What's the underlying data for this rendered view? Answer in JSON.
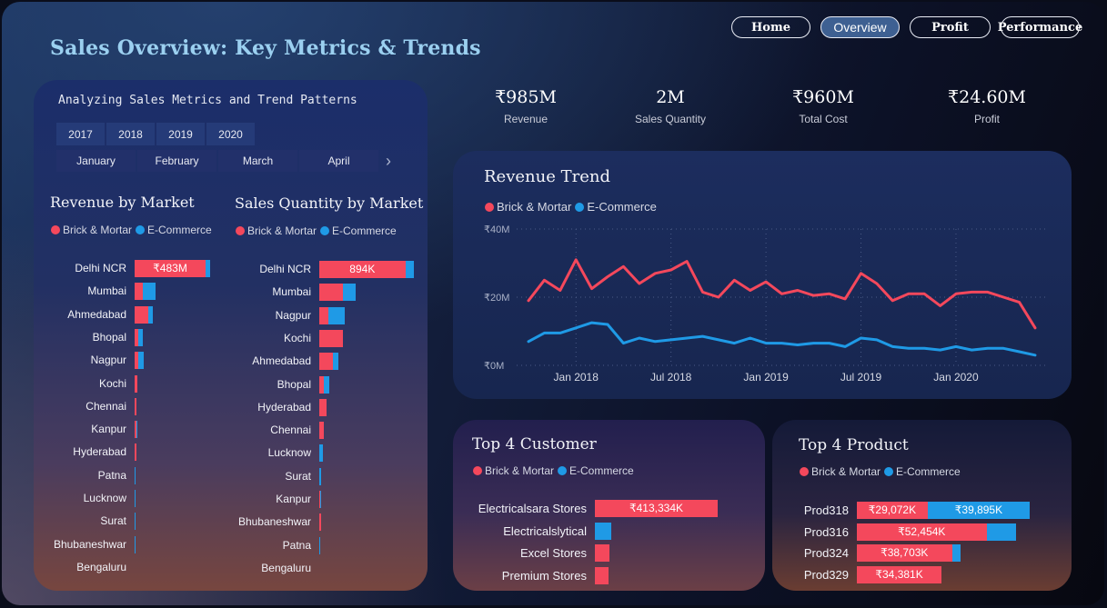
{
  "page_title": "Sales Overview: Key Metrics & Trends",
  "nav": [
    {
      "label": "Home",
      "active": false,
      "width": 87
    },
    {
      "label": "Overview",
      "active": true,
      "width": 87
    },
    {
      "label": "Profit",
      "active": false,
      "width": 89
    },
    {
      "label": "Performance",
      "active": false,
      "width": 87
    }
  ],
  "subheading": "Analyzing Sales Metrics and Trend Patterns",
  "years": [
    "2017",
    "2018",
    "2019",
    "2020"
  ],
  "months": [
    "January",
    "February",
    "March",
    "April"
  ],
  "kpis": [
    {
      "value": "₹985M",
      "label": "Revenue"
    },
    {
      "value": "2M",
      "label": "Sales Quantity"
    },
    {
      "value": "₹960M",
      "label": "Total Cost"
    },
    {
      "value": "₹24.60M",
      "label": "Profit"
    }
  ],
  "legend": {
    "brick": "Brick & Mortar",
    "ecom": "E-Commerce"
  },
  "colors": {
    "brick": "#f4485c",
    "ecom": "#1f9ae6"
  },
  "revenue_by_market": {
    "title": "Revenue by Market",
    "rows": [
      {
        "label": "Delhi NCR",
        "brick": 1.0,
        "ecom": 0.07,
        "text": "₹483M"
      },
      {
        "label": "Mumbai",
        "brick": 0.12,
        "ecom": 0.17,
        "text": ""
      },
      {
        "label": "Ahmedabad",
        "brick": 0.19,
        "ecom": 0.07,
        "text": ""
      },
      {
        "label": "Bhopal",
        "brick": 0.05,
        "ecom": 0.06,
        "text": ""
      },
      {
        "label": "Nagpur",
        "brick": 0.05,
        "ecom": 0.08,
        "text": ""
      },
      {
        "label": "Kochi",
        "brick": 0.04,
        "ecom": 0.0,
        "text": ""
      },
      {
        "label": "Chennai",
        "brick": 0.03,
        "ecom": 0.0,
        "text": ""
      },
      {
        "label": "Kanpur",
        "brick": 0.02,
        "ecom": 0.01,
        "text": ""
      },
      {
        "label": "Hyderabad",
        "brick": 0.02,
        "ecom": 0.0,
        "text": ""
      },
      {
        "label": "Patna",
        "brick": 0.0,
        "ecom": 0.01,
        "text": ""
      },
      {
        "label": "Lucknow",
        "brick": 0.0,
        "ecom": 0.01,
        "text": ""
      },
      {
        "label": "Surat",
        "brick": 0.0,
        "ecom": 0.01,
        "text": ""
      },
      {
        "label": "Bhubaneshwar",
        "brick": 0.0,
        "ecom": 0.01,
        "text": ""
      },
      {
        "label": "Bengaluru",
        "brick": 0.0,
        "ecom": 0.0,
        "text": ""
      }
    ]
  },
  "quantity_by_market": {
    "title": "Sales Quantity by Market",
    "rows": [
      {
        "label": "Delhi NCR",
        "brick": 0.91,
        "ecom": 0.09,
        "text": "894K"
      },
      {
        "label": "Mumbai",
        "brick": 0.25,
        "ecom": 0.13,
        "text": ""
      },
      {
        "label": "Nagpur",
        "brick": 0.1,
        "ecom": 0.17,
        "text": ""
      },
      {
        "label": "Kochi",
        "brick": 0.25,
        "ecom": 0.0,
        "text": ""
      },
      {
        "label": "Ahmedabad",
        "brick": 0.14,
        "ecom": 0.06,
        "text": ""
      },
      {
        "label": "Bhopal",
        "brick": 0.05,
        "ecom": 0.06,
        "text": ""
      },
      {
        "label": "Hyderabad",
        "brick": 0.08,
        "ecom": 0.0,
        "text": ""
      },
      {
        "label": "Chennai",
        "brick": 0.05,
        "ecom": 0.0,
        "text": ""
      },
      {
        "label": "Lucknow",
        "brick": 0.0,
        "ecom": 0.04,
        "text": ""
      },
      {
        "label": "Surat",
        "brick": 0.0,
        "ecom": 0.02,
        "text": ""
      },
      {
        "label": "Kanpur",
        "brick": 0.01,
        "ecom": 0.01,
        "text": ""
      },
      {
        "label": "Bhubaneshwar",
        "brick": 0.02,
        "ecom": 0.0,
        "text": ""
      },
      {
        "label": "Patna",
        "brick": 0.0,
        "ecom": 0.01,
        "text": ""
      },
      {
        "label": "Bengaluru",
        "brick": 0.0,
        "ecom": 0.0,
        "text": ""
      }
    ]
  },
  "top_customers": {
    "title": "Top 4 Customer",
    "rows": [
      {
        "label": "Electricalsara Stores",
        "brick": 1.0,
        "ecom": 0.0,
        "text": "₹413,334K"
      },
      {
        "label": "Electricalslytical",
        "brick": 0.0,
        "ecom": 0.13,
        "text": ""
      },
      {
        "label": "Excel Stores",
        "brick": 0.12,
        "ecom": 0.0,
        "text": ""
      },
      {
        "label": "Premium Stores",
        "brick": 0.11,
        "ecom": 0.0,
        "text": ""
      }
    ]
  },
  "top_products": {
    "title": "Top 4 Product",
    "rows": [
      {
        "label": "Prod318",
        "brick": 0.41,
        "ecom": 0.59,
        "text": "₹29,072K",
        "text2": "₹39,895K"
      },
      {
        "label": "Prod316",
        "brick": 0.75,
        "ecom": 0.17,
        "text": "₹52,454K",
        "text2": ""
      },
      {
        "label": "Prod324",
        "brick": 0.55,
        "ecom": 0.05,
        "text": "₹38,703K",
        "text2": ""
      },
      {
        "label": "Prod329",
        "brick": 0.49,
        "ecom": 0.0,
        "text": "₹34,381K",
        "text2": ""
      }
    ]
  },
  "revenue_trend": {
    "title": "Revenue Trend",
    "y_ticks": [
      "₹40M",
      "₹20M",
      "₹0M"
    ],
    "x_ticks": [
      "Jan 2018",
      "Jul 2018",
      "Jan 2019",
      "Jul 2019",
      "Jan 2020"
    ]
  },
  "chart_data": {
    "type": "line",
    "title": "Revenue Trend",
    "x_unit": "month",
    "x_start": "2017-10",
    "x_end": "2020-06",
    "ylim": [
      0,
      40
    ],
    "y_unit": "₹M",
    "series": [
      {
        "name": "Brick & Mortar",
        "color": "#f4485c",
        "values": [
          19,
          25,
          22,
          31,
          22.5,
          26,
          29,
          24,
          27,
          28,
          30.5,
          21.5,
          20,
          25,
          22,
          24.5,
          21,
          22,
          20.5,
          21,
          19.5,
          27,
          24,
          19,
          21,
          21,
          17.5,
          21,
          21.5,
          21.5,
          20,
          18.5,
          11
        ]
      },
      {
        "name": "E-Commerce",
        "color": "#1f9ae6",
        "values": [
          7,
          9.5,
          9.5,
          11,
          12.5,
          12,
          6.5,
          8,
          7,
          7.5,
          8,
          8.5,
          7.5,
          6.5,
          8,
          6.5,
          6.5,
          6,
          6.5,
          6.5,
          5.5,
          8,
          7.5,
          5.5,
          5,
          5,
          4.5,
          5.5,
          4.5,
          5,
          5,
          4,
          3
        ]
      }
    ]
  }
}
